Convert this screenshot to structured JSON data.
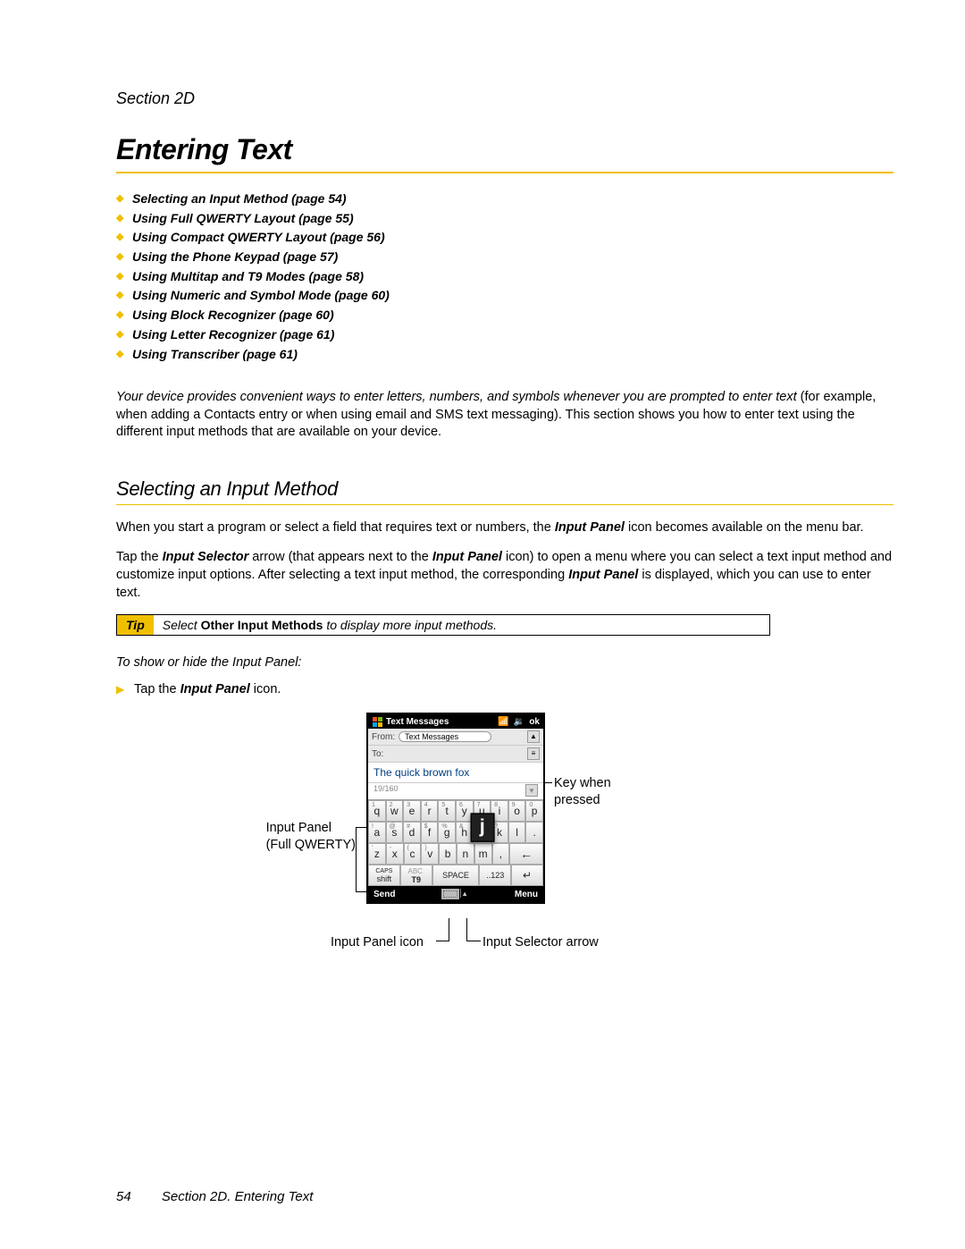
{
  "section_label": "Section 2D",
  "title": "Entering Text",
  "toc": [
    "Selecting an Input Method (page 54)",
    "Using Full QWERTY Layout (page 55)",
    "Using Compact QWERTY Layout (page 56)",
    "Using the Phone Keypad (page 57)",
    "Using Multitap and T9 Modes (page 58)",
    "Using Numeric and Symbol Mode (page 60)",
    "Using Block Recognizer (page 60)",
    "Using Letter Recognizer (page 61)",
    "Using Transcriber (page 61)"
  ],
  "intro_lead": "Your device provides convenient ways to enter letters, numbers, and symbols whenever you are prompted to enter text",
  "intro_tail": " (for example, when adding a Contacts entry or when using email and SMS text messaging). This section shows you how to enter text using the different input methods that are available on your device.",
  "subhead": "Selecting an Input Method",
  "para1_pre": "When you start a program or select a field that requires text or numbers, the ",
  "para1_term": "Input Panel",
  "para1_post": " icon becomes available on the menu bar.",
  "para2_a": "Tap the ",
  "para2_b": "Input Selector",
  "para2_c": " arrow (that appears next to the ",
  "para2_d": "Input Panel",
  "para2_e": " icon) to open a menu where you can select a text input method and customize input options. After selecting a text input method, the corresponding ",
  "para2_f": "Input Panel",
  "para2_g": " is displayed, which you can use to enter text.",
  "tip_label": "Tip",
  "tip_pre": "Select ",
  "tip_bold": "Other Input Methods",
  "tip_post": " to display more input methods.",
  "proc_head": "To show or hide the Input Panel:",
  "step_pre": "Tap the ",
  "step_term": "Input Panel",
  "step_post": " icon.",
  "callouts": {
    "input_panel": "Input Panel\n(Full QWERTY)",
    "key_pressed": "Key when\npressed",
    "ip_icon": "Input Panel icon",
    "selector": "Input Selector arrow"
  },
  "phone": {
    "title": "Text Messages",
    "ok": "ok",
    "from_lbl": "From:",
    "from_val": "Text Messages",
    "to_lbl": "To:",
    "text": "The quick brown fox",
    "count": "19/160",
    "rows": {
      "r1": [
        "q",
        "w",
        "e",
        "r",
        "t",
        "y",
        "u",
        "i",
        "o",
        "p"
      ],
      "r1n": [
        "1",
        "2",
        "3",
        "4",
        "5",
        "6",
        "7",
        "8",
        "9",
        "0"
      ],
      "r2": [
        "a",
        "s",
        "d",
        "f",
        "g",
        "h",
        "j",
        "k",
        "l",
        "."
      ],
      "r2n": [
        "!",
        "@",
        "#",
        "$",
        "%",
        "&",
        "*",
        "?",
        "",
        ""
      ],
      "r3": [
        "z",
        "x",
        "c",
        "v",
        "b",
        "n",
        "m",
        ","
      ],
      "r3n": [
        "'",
        "-",
        "(",
        ")",
        "",
        "",
        "",
        ""
      ]
    },
    "caps": "CAPS",
    "shift": "shift",
    "abc": "ABC",
    "t9": "T9",
    "space": "SPACE",
    "sym": "..123",
    "send": "Send",
    "menu": "Menu"
  },
  "footer_page": "54",
  "footer_text": "Section 2D. Entering Text"
}
